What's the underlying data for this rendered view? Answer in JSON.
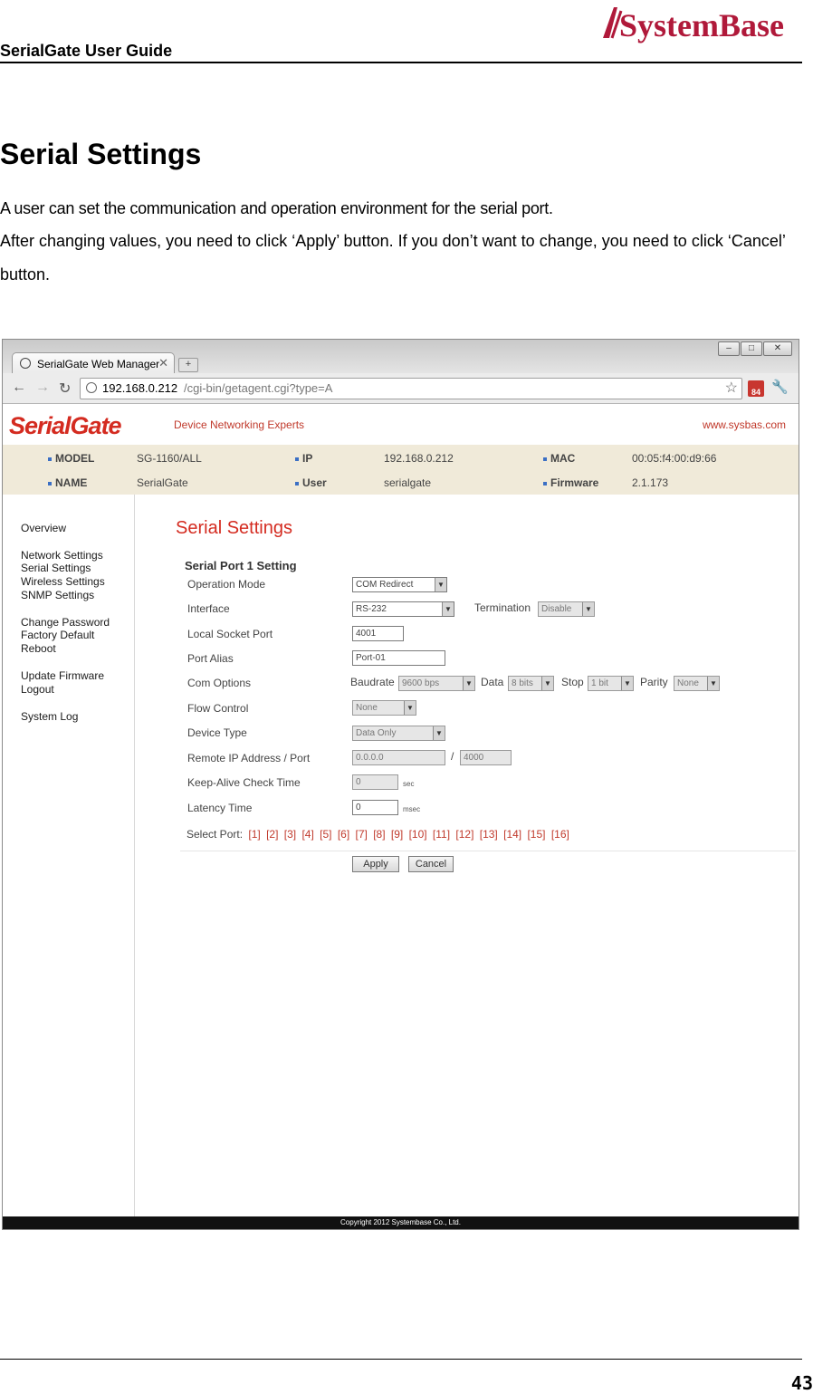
{
  "doc": {
    "header_title": "SerialGate User Guide",
    "logo_text": "SystemBase",
    "section_title": "Serial Settings",
    "para1": "A user can set the communication and operation environment for the serial port.",
    "para2": "After changing values, you need to click ‘Apply’ button. If you don’t want to change, you need to click ‘Cancel’ button.",
    "page_number": "43"
  },
  "browser": {
    "tab_title": "SerialGate Web Manager",
    "url_host": "192.168.0.212",
    "url_path": "/cgi-bin/getagent.cgi?type=A",
    "ext_badge": "84"
  },
  "site": {
    "logo": "SerialGate",
    "tagline": "Device Networking Experts",
    "website": "www.sysbas.com",
    "info": {
      "model_key": "MODEL",
      "model_val": "SG-1160/ALL",
      "ip_key": "IP",
      "ip_val": "192.168.0.212",
      "mac_key": "MAC",
      "mac_val": "00:05:f4:00:d9:66",
      "name_key": "NAME",
      "name_val": "SerialGate",
      "user_key": "User",
      "user_val": "serialgate",
      "fw_key": "Firmware",
      "fw_val": "2.1.173"
    },
    "nav": [
      "Overview",
      "Network Settings",
      "Serial Settings",
      "Wireless Settings",
      "SNMP Settings",
      "Change Password",
      "Factory Default",
      "Reboot",
      "Update Firmware",
      "Logout",
      "System Log"
    ],
    "page_title": "Serial Settings",
    "subtitle": "Serial Port 1 Setting",
    "labels": {
      "operation_mode": "Operation Mode",
      "interface": "Interface",
      "local_socket_port": "Local Socket Port",
      "port_alias": "Port Alias",
      "com_options": "Com Options",
      "flow_control": "Flow Control",
      "device_type": "Device Type",
      "remote_ip": "Remote IP Address / Port",
      "keepalive": "Keep-Alive Check Time",
      "latency": "Latency Time"
    },
    "values": {
      "operation_mode": "COM Redirect",
      "interface": "RS-232",
      "termination_label": "Termination",
      "termination": "Disable",
      "local_socket_port": "4001",
      "port_alias": "Port-01",
      "baudrate_label": "Baudrate",
      "baudrate": "9600 bps",
      "data_label": "Data",
      "data": "8 bits",
      "stop_label": "Stop",
      "stop": "1 bit",
      "parity_label": "Parity",
      "parity": "None",
      "flow_control": "None",
      "device_type": "Data Only",
      "remote_ip": "0.0.0.0",
      "slash": "/",
      "remote_port": "4000",
      "keepalive": "0",
      "keepalive_unit": "sec",
      "latency": "0",
      "latency_unit": "msec"
    },
    "select_port_label": "Select Port:",
    "ports": [
      "[1]",
      "[2]",
      "[3]",
      "[4]",
      "[5]",
      "[6]",
      "[7]",
      "[8]",
      "[9]",
      "[10]",
      "[11]",
      "[12]",
      "[13]",
      "[14]",
      "[15]",
      "[16]"
    ],
    "apply": "Apply",
    "cancel": "Cancel",
    "copyright": "Copyright 2012 Systembase Co., Ltd."
  }
}
